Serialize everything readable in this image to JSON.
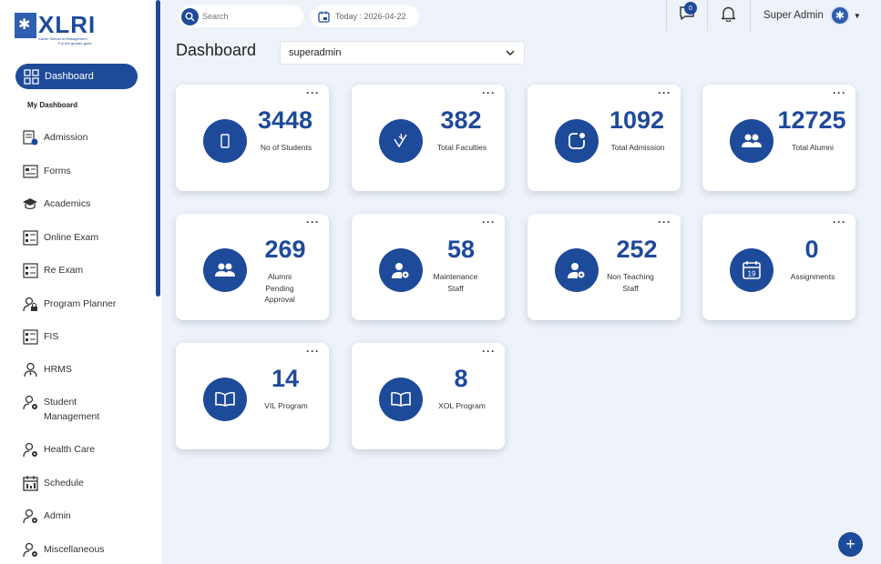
{
  "logo": {
    "word": "XLRI",
    "tagline": "Xavier School of Management",
    "motto": "For the greater good"
  },
  "sidebar": {
    "active": "Dashboard",
    "sub": "My Dashboard",
    "items": [
      {
        "label": "Admission"
      },
      {
        "label": "Forms"
      },
      {
        "label": "Academics"
      },
      {
        "label": "Online Exam"
      },
      {
        "label": "Re Exam"
      },
      {
        "label": "Program Planner"
      },
      {
        "label": "FIS"
      },
      {
        "label": "HRMS"
      },
      {
        "label": "Student Management"
      },
      {
        "label": "Health Care"
      },
      {
        "label": "Schedule"
      },
      {
        "label": "Admin"
      },
      {
        "label": "Miscellaneous"
      }
    ]
  },
  "topbar": {
    "search_placeholder": "Search",
    "today": "Today : 2026-04-22",
    "message_count": "0",
    "user_name": "Super Admin"
  },
  "header": {
    "title": "Dashboard",
    "role_select": "superadmin"
  },
  "cards": [
    {
      "value": "3448",
      "label": "No of Students",
      "icon": "mobile-icon"
    },
    {
      "value": "382",
      "label": "Total Faculties",
      "icon": "faculty-icon"
    },
    {
      "value": "1092",
      "label": "Total Admission",
      "icon": "admission-icon"
    },
    {
      "value": "12725",
      "label": "Total Alumni",
      "icon": "alumni-icon"
    },
    {
      "value": "269",
      "label": "Alumni Pending Approval",
      "icon": "alumni-pending-icon"
    },
    {
      "value": "58",
      "label": "Maintenance Staff",
      "icon": "staff-gear-icon"
    },
    {
      "value": "252",
      "label": "Non Teaching Staff",
      "icon": "staff-gear-icon"
    },
    {
      "value": "0",
      "label": "Assignments",
      "icon": "calendar-icon"
    },
    {
      "value": "14",
      "label": "VIL Program",
      "icon": "book-icon"
    },
    {
      "value": "8",
      "label": "XOL Program",
      "icon": "book-icon"
    }
  ],
  "colors": {
    "brand": "#1e4a9a",
    "background": "#eef2f9"
  }
}
